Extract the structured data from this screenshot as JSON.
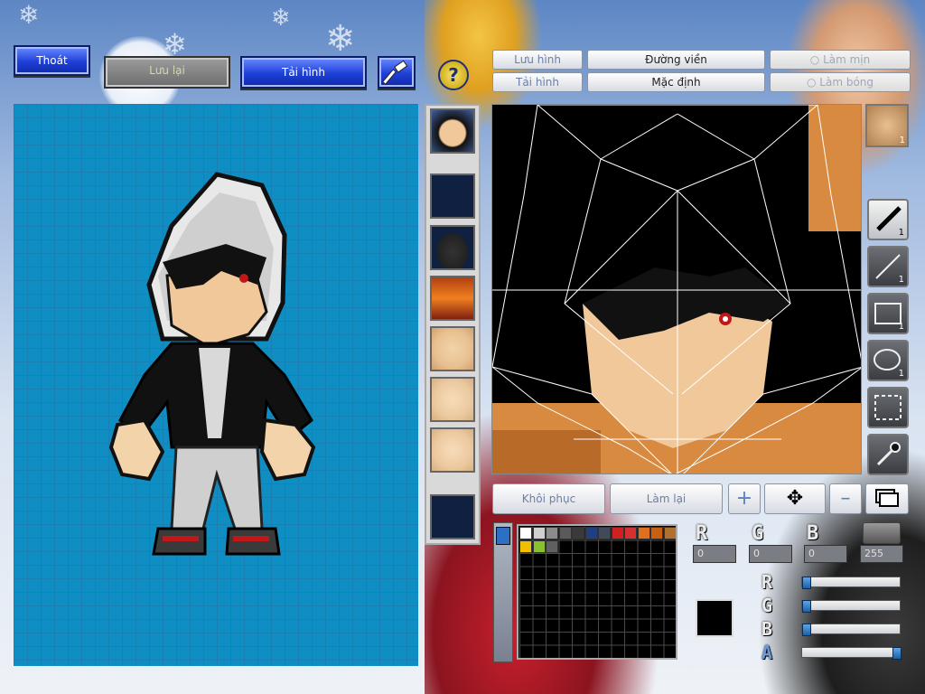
{
  "toolbar": {
    "exit_label": "Thoát",
    "save_label": "Lưu lại",
    "reload_label": "Tải hình",
    "help_symbol": "?"
  },
  "options": {
    "save_image_label": "Lưu hình",
    "load_image_label": "Tải hình",
    "outline_label": "Đường viền",
    "default_label": "Mặc định",
    "smooth_label": "Làm mịn",
    "shade_label": "Làm bóng"
  },
  "tools": {
    "pen_count": "1",
    "line_count": "1",
    "rect_count": "1",
    "ellipse_count": "1",
    "portrait_count": "1"
  },
  "actions": {
    "restore_label": "Khôi phục",
    "redo_label": "Làm lại"
  },
  "color": {
    "r_label": "R",
    "g_label": "G",
    "b_label": "B",
    "r_value": "0",
    "g_value": "0",
    "b_value": "0",
    "a_value": "255",
    "slider_r_label": "R",
    "slider_g_label": "G",
    "slider_b_label": "B",
    "slider_a_label": "A",
    "current": "#000000",
    "slider_levels": [
      0,
      0,
      0,
      1
    ]
  },
  "palette": {
    "row1": [
      "#ffffff",
      "#d0d0d0",
      "#8c8c8c",
      "#5a5a5a",
      "#3a3a3a",
      "#1f3f80",
      "#404a5a",
      "#d02020",
      "#d83030",
      "#e07020",
      "#c86010",
      "#b07030"
    ],
    "row2": [
      "#f0c000",
      "#88c030",
      "#606060"
    ]
  }
}
